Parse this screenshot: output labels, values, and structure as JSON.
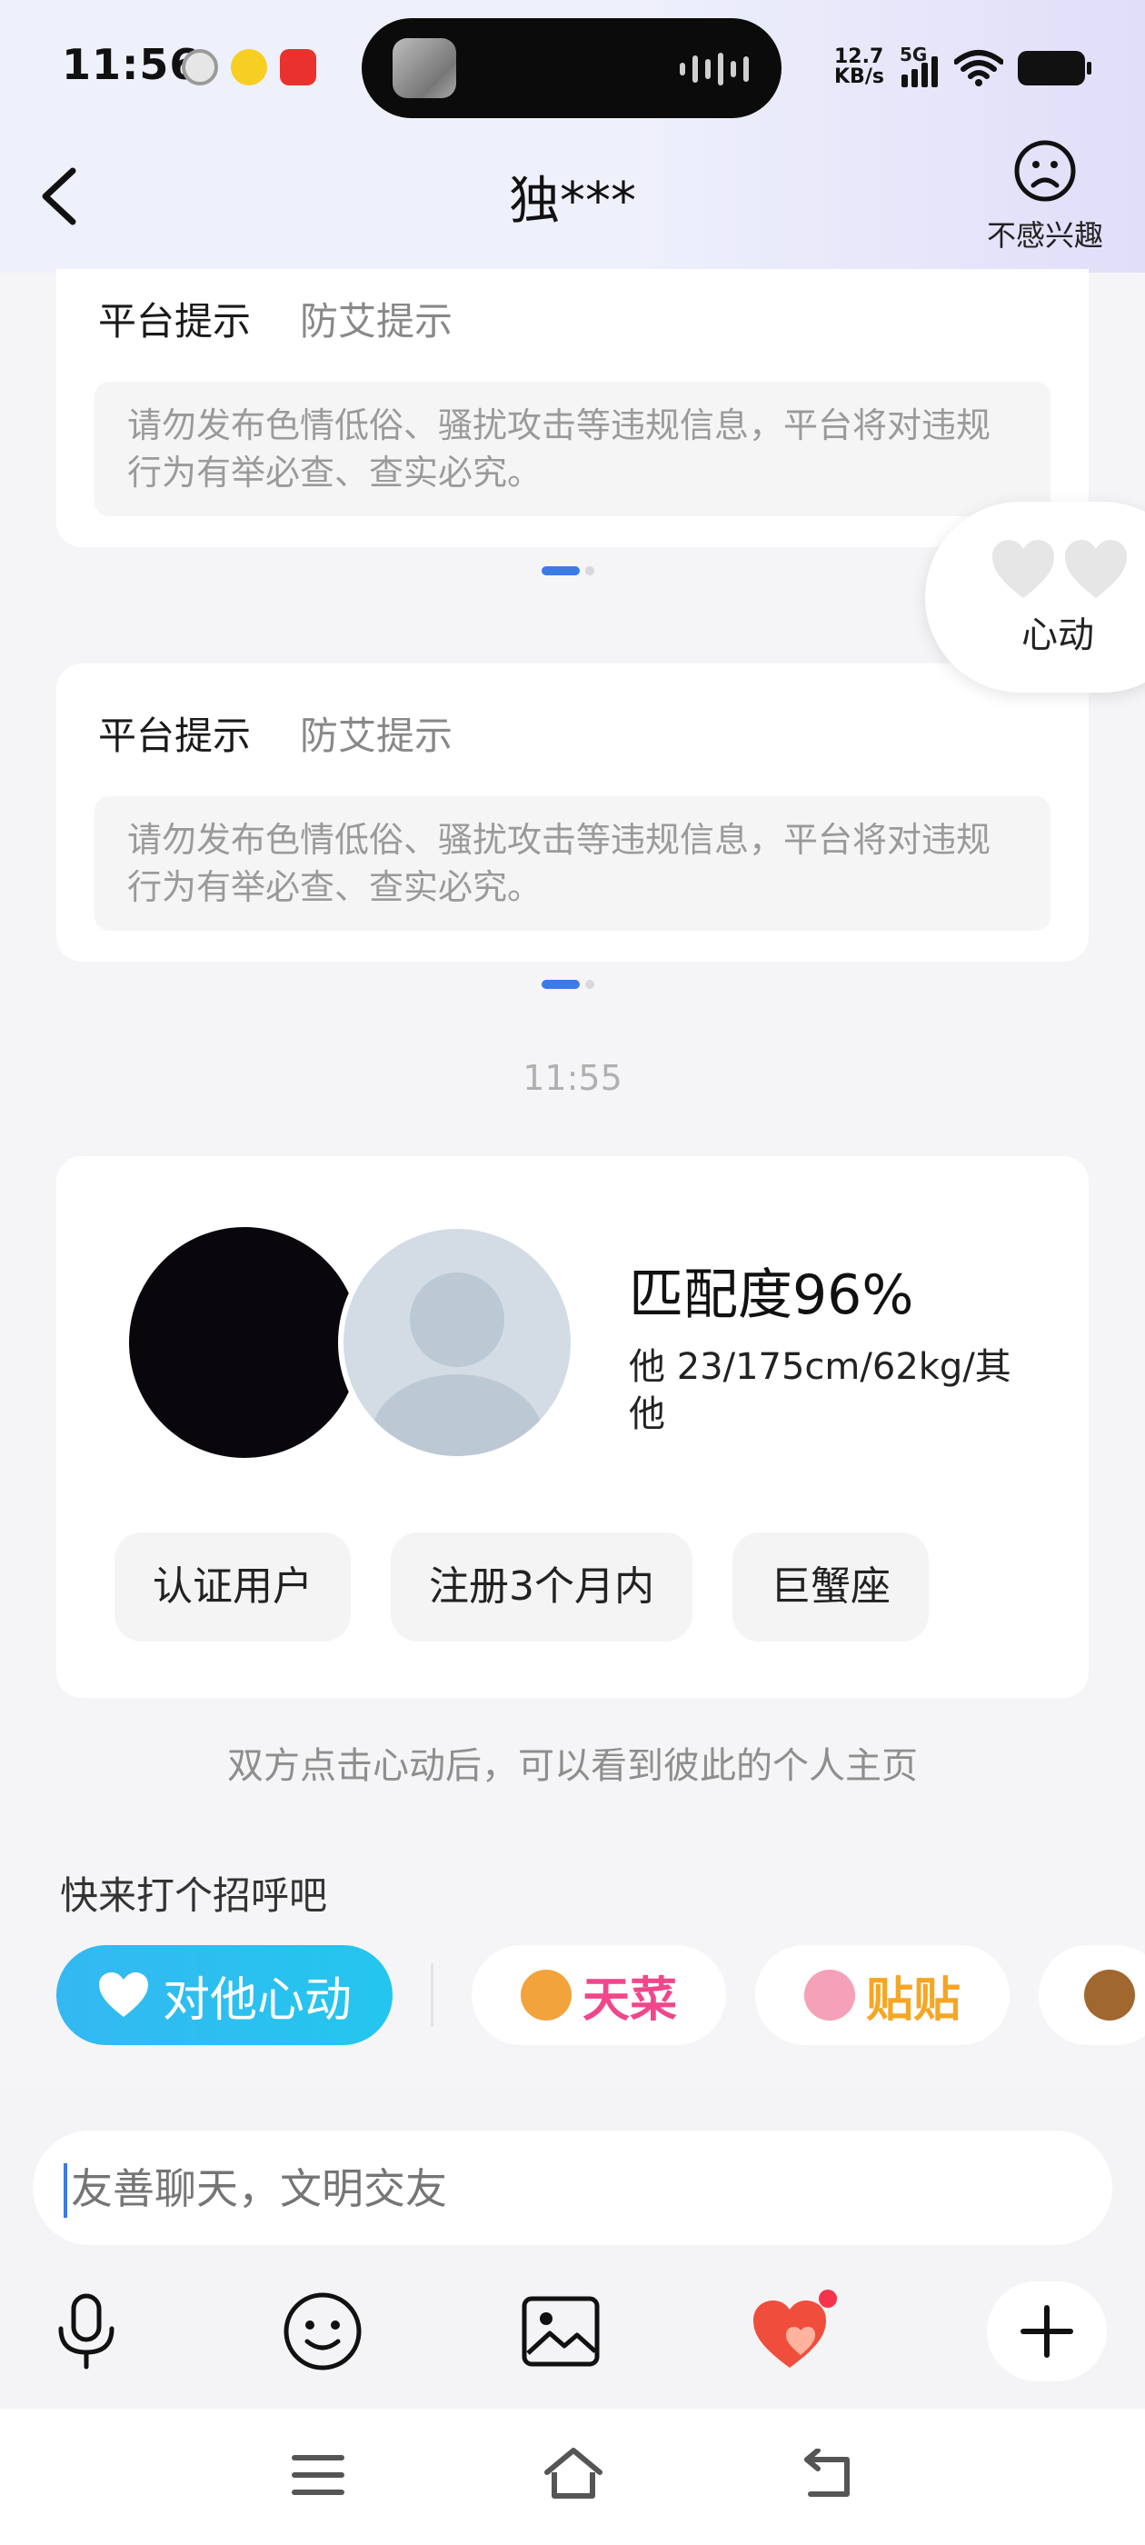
{
  "status_bar": {
    "time": "11:56",
    "net_speed_value": "12.7",
    "net_speed_unit": "KB/s",
    "signal_label": "5G"
  },
  "header": {
    "title": "独***",
    "dislike_label": "不感兴趣"
  },
  "notices": [
    {
      "tab_active": "平台提示",
      "tab_other": "防艾提示",
      "text": "请勿发布色情低俗、骚扰攻击等违规信息，平台将对违规行为有举必查、查实必究。"
    },
    {
      "tab_active": "平台提示",
      "tab_other": "防艾提示",
      "text": "请勿发布色情低俗、骚扰攻击等违规信息，平台将对违规行为有举必查、查实必究。"
    }
  ],
  "float_button": {
    "label": "心动"
  },
  "timestamp": "11:55",
  "match": {
    "title": "匹配度96%",
    "info": "他 23/175cm/62kg/其他",
    "tags": [
      "认证用户",
      "注册3个月内",
      "巨蟹座"
    ]
  },
  "hint": "双方点击心动后，可以看到彼此的个人主页",
  "greet": {
    "title": "快来打个招呼吧",
    "heart_button": "对他心动",
    "stickers": [
      {
        "label": "天菜",
        "color": "#f0468c"
      },
      {
        "label": "贴贴",
        "color": "#f5a623"
      }
    ]
  },
  "input": {
    "placeholder": "友善聊天，文明交友"
  },
  "colors": {
    "accent_blue": "#3a7be6",
    "heart_gradient_start": "#34b8f2",
    "like_red": "#f04e3c"
  },
  "icons": {
    "toolbar": [
      "microphone-icon",
      "emoji-icon",
      "image-icon",
      "heart-gift-icon",
      "plus-icon"
    ],
    "navbar": [
      "menu-icon",
      "home-icon",
      "back-icon"
    ]
  }
}
